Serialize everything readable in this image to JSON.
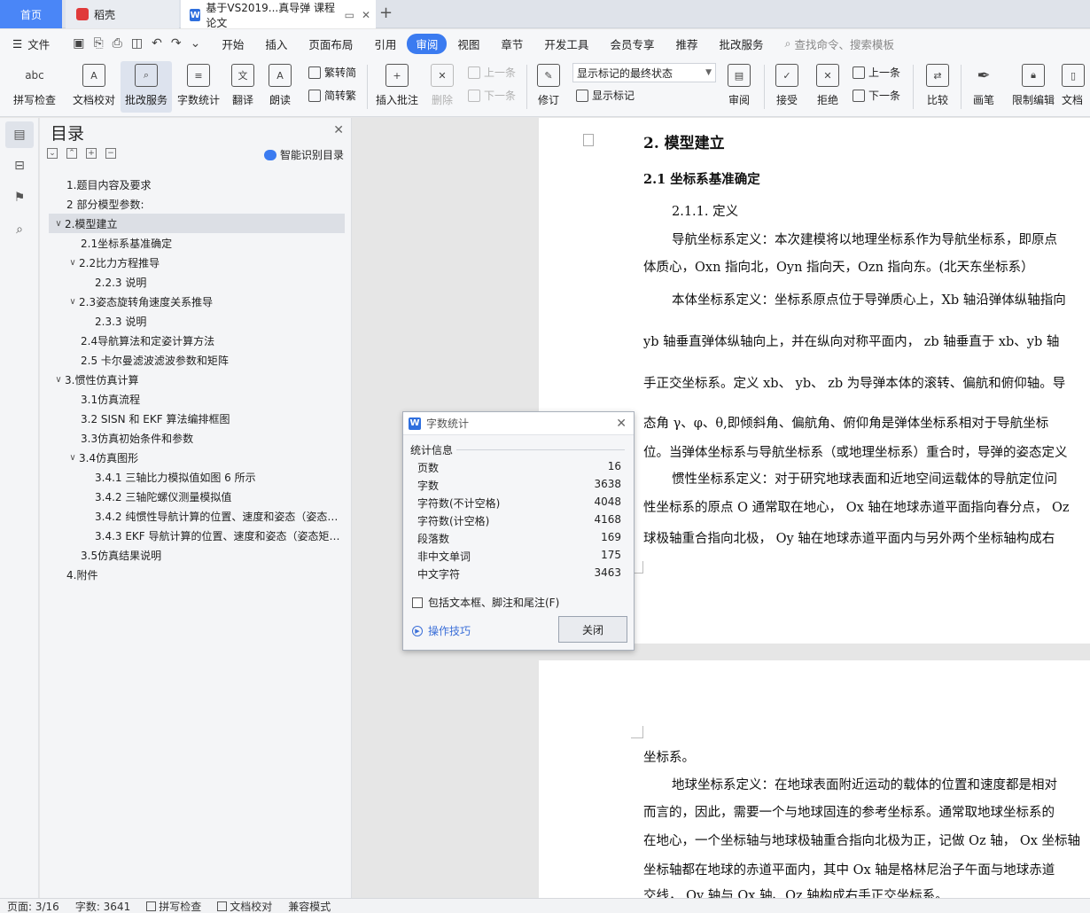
{
  "tabs": {
    "home": "首页",
    "daoke": "稻壳",
    "doc": "基于VS2019...真导弹 课程论文",
    "plus": "+"
  },
  "menu": {
    "file": "文件",
    "items": [
      "开始",
      "插入",
      "页面布局",
      "引用",
      "审阅",
      "视图",
      "章节",
      "开发工具",
      "会员专享",
      "推荐",
      "批改服务"
    ],
    "active": "审阅",
    "search": "查找命令、搜索模板"
  },
  "ribbon": {
    "spell": "拼写检查",
    "spell_icon": "abc",
    "proof": "文档校对",
    "correct": "批改服务",
    "wordcount": "字数统计",
    "translate": "翻译",
    "read": "朗读",
    "trad": "繁转简",
    "simp": "简转繁",
    "insert_comment": "插入批注",
    "delete": "删除",
    "prev_comment": "上一条",
    "next_comment": "下一条",
    "revise": "修订",
    "markup_select": "显示标记的最终状态",
    "show_markup": "显示标记",
    "review": "审阅",
    "accept": "接受",
    "reject": "拒绝",
    "prev": "上一条",
    "next": "下一条",
    "compare": "比较",
    "pen": "画笔",
    "restrict": "限制编辑",
    "doc_more": "文档"
  },
  "nav": {
    "title": "目录",
    "smart": "智能识别目录",
    "items": [
      {
        "text": "1.题目内容及要求",
        "level": 1,
        "arrow": ""
      },
      {
        "text": "2 部分模型参数:",
        "level": 1,
        "arrow": ""
      },
      {
        "text": "2.模型建立",
        "level": 1,
        "arrow": "∨",
        "selected": true
      },
      {
        "text": "2.1坐标系基准确定",
        "level": 2,
        "arrow": ""
      },
      {
        "text": "2.2比力方程推导",
        "level": 2,
        "arrow": "∨"
      },
      {
        "text": "2.2.3  说明",
        "level": 3,
        "arrow": ""
      },
      {
        "text": "2.3姿态旋转角速度关系推导",
        "level": 2,
        "arrow": "∨"
      },
      {
        "text": "2.3.3  说明",
        "level": 3,
        "arrow": ""
      },
      {
        "text": "2.4导航算法和定姿计算方法",
        "level": 2,
        "arrow": ""
      },
      {
        "text": "2.5 卡尔曼滤波滤波参数和矩阵",
        "level": 2,
        "arrow": ""
      },
      {
        "text": "3.惯性仿真计算",
        "level": 1,
        "arrow": "∨"
      },
      {
        "text": "3.1仿真流程",
        "level": 2,
        "arrow": ""
      },
      {
        "text": "3.2  SISN 和 EKF 算法编排框图",
        "level": 2,
        "arrow": ""
      },
      {
        "text": "3.3仿真初始条件和参数",
        "level": 2,
        "arrow": ""
      },
      {
        "text": "3.4仿真图形",
        "level": 2,
        "arrow": "∨"
      },
      {
        "text": "3.4.1  三轴比力模拟值如图 6 所示",
        "level": 3,
        "arrow": ""
      },
      {
        "text": "3.4.2  三轴陀螺仪测量模拟值",
        "level": 3,
        "arrow": ""
      },
      {
        "text": "3.4.2  纯惯性导航计算的位置、速度和姿态（姿态…",
        "level": 3,
        "arrow": ""
      },
      {
        "text": "3.4.3 EKF 导航计算的位置、速度和姿态（姿态矩…",
        "level": 3,
        "arrow": ""
      },
      {
        "text": "3.5仿真结果说明",
        "level": 2,
        "arrow": ""
      },
      {
        "text": "4.附件",
        "level": 1,
        "arrow": ""
      }
    ]
  },
  "doc": {
    "h2": "2.  模型建立",
    "h3": "2.1  坐标系基准确定",
    "sub": "2.1.1.    定义",
    "p1a": "导航坐标系定义：本次建模将以地理坐标系作为导航坐标系，即原点",
    "p1b": "体质心，Oxn 指向北，Oyn 指向天，Ozn 指向东。(北天东坐标系）",
    "p2a": "本体坐标系定义：坐标系原点位于导弹质心上，Xb 轴沿弹体纵轴指向",
    "p2b": "yb  轴垂直弹体纵轴向上，并在纵向对称平面内，  zb 轴垂直于 xb、yb 轴",
    "p2c": "手正交坐标系。定义 xb、 yb、 zb 为导弹本体的滚转、偏航和俯仰轴。导",
    "p2d": "态角 γ、φ、θ,即倾斜角、偏航角、俯仰角是弹体坐标系相对于导航坐标",
    "p2e": "位。当弹体坐标系与导航坐标系（或地理坐标系）重合时，导弹的姿态定义",
    "p3a": "惯性坐标系定义：对于研究地球表面和近地空间运载体的导航定位问",
    "p3b": "性坐标系的原点 O 通常取在地心，  Ox 轴在地球赤道平面指向春分点，  Oz",
    "p3c": "球极轴重合指向北极，  Oy 轴在地球赤道平面内与另外两个坐标轴构成右",
    "p4a": "坐标系。",
    "p5a": "地球坐标系定义：在地球表面附近运动的载体的位置和速度都是相对",
    "p5b": "而言的，因此，需要一个与地球固连的参考坐标系。通常取地球坐标系的",
    "p5c": "在地心，一个坐标轴与地球极轴重合指向北极为正，记做 Oz 轴，  Ox 坐标轴",
    "p5d": "坐标轴都在地球的赤道平面内，其中 Ox 轴是格林尼治子午面与地球赤道",
    "p5e": "交线，  Oy 轴与 Ox 轴、Oz 轴构成右手正交坐标系。"
  },
  "dialog": {
    "title": "字数统计",
    "section": "统计信息",
    "rows": [
      {
        "label": "页数",
        "value": "16"
      },
      {
        "label": "字数",
        "value": "3638"
      },
      {
        "label": "字符数(不计空格)",
        "value": "4048"
      },
      {
        "label": "字符数(计空格)",
        "value": "4168"
      },
      {
        "label": "段落数",
        "value": "169"
      },
      {
        "label": "非中文单词",
        "value": "175"
      },
      {
        "label": "中文字符",
        "value": "3463"
      }
    ],
    "checkbox": "包括文本框、脚注和尾注(F)",
    "tips": "操作技巧",
    "close": "关闭"
  },
  "status": {
    "page": "页面: 3/16",
    "words": "字数: 3641",
    "spell": "拼写检查",
    "proof": "文档校对",
    "compat": "兼容模式"
  },
  "colors": {
    "accent": "#3b7bf0",
    "home_tab": "#4a86f7"
  }
}
